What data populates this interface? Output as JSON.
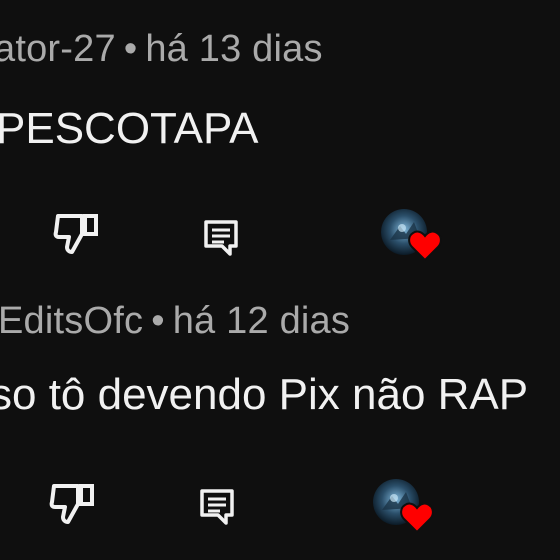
{
  "comments": [
    {
      "author": "ator-27",
      "separator": "•",
      "time": "há 13 dias",
      "text": "PESCOTAPA",
      "icons": {
        "dislike": "thumbs-down-icon",
        "reply": "comment-reply-icon",
        "hearted": "creator-heart-icon"
      }
    },
    {
      "author": "EditsOfc",
      "separator": "•",
      "time": "há 12 dias",
      "text": "so tô devendo Pix não RAP",
      "icons": {
        "dislike": "thumbs-down-icon",
        "reply": "comment-reply-icon",
        "hearted": "creator-heart-icon"
      }
    }
  ],
  "colors": {
    "background": "#0f0f0f",
    "text": "#f1f1f1",
    "meta": "#aaaaaa",
    "heart": "#ff0000"
  }
}
